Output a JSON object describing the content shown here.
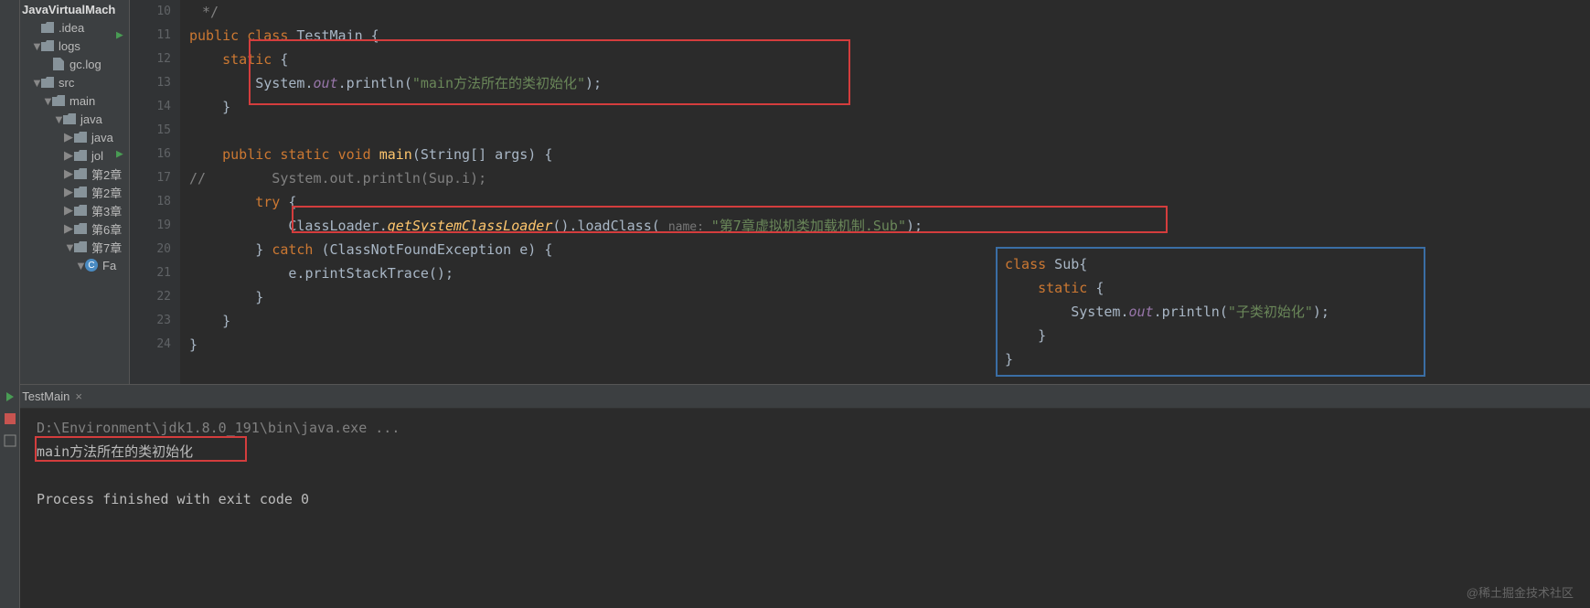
{
  "project": {
    "root": "JavaVirtualMach",
    "nodes": [
      {
        "label": ".idea",
        "type": "folder",
        "depth": 1
      },
      {
        "label": "logs",
        "type": "folder",
        "depth": 1,
        "open": true
      },
      {
        "label": "gc.log",
        "type": "file",
        "depth": 2
      },
      {
        "label": "src",
        "type": "folder",
        "depth": 1,
        "open": true
      },
      {
        "label": "main",
        "type": "folder",
        "depth": 2,
        "open": true
      },
      {
        "label": "java",
        "type": "folder",
        "depth": 3,
        "open": true
      },
      {
        "label": "java",
        "type": "folder",
        "depth": 4,
        "has_child": true
      },
      {
        "label": "jol",
        "type": "folder",
        "depth": 4,
        "has_child": true
      },
      {
        "label": "第2章",
        "type": "folder",
        "depth": 4,
        "has_child": true
      },
      {
        "label": "第2章",
        "type": "folder",
        "depth": 4,
        "has_child": true
      },
      {
        "label": "第3章",
        "type": "folder",
        "depth": 4,
        "has_child": true
      },
      {
        "label": "第6章",
        "type": "folder",
        "depth": 4,
        "has_child": true
      },
      {
        "label": "第7章",
        "type": "folder",
        "depth": 4,
        "open": true
      },
      {
        "label": "Fa",
        "type": "class",
        "depth": 5,
        "open": true
      }
    ]
  },
  "lineNumbers": [
    "10",
    "11",
    "12",
    "13",
    "14",
    "15",
    "16",
    "17",
    "18",
    "19",
    "20",
    "21",
    "22",
    "23",
    "24"
  ],
  "runMarkers": {
    "11": true,
    "16": true
  },
  "code": {
    "l10": "*/",
    "l11_kw1": "public",
    "l11_kw2": "class",
    "l11_cls": "TestMain",
    "l11_brace": " {",
    "l12_kw": "static",
    "l12_brace": " {",
    "l13_sys": "System",
    "l13_dot1": ".",
    "l13_out": "out",
    "l13_dot2": ".",
    "l13_println": "println",
    "l13_p1": "(",
    "l13_str": "\"main方法所在的类初始化\"",
    "l13_p2": ");",
    "l14": "}",
    "l16_kw1": "public",
    "l16_kw2": "static",
    "l16_kw3": "void",
    "l16_mth": "main",
    "l16_p1": "(",
    "l16_type": "String[]",
    "l16_arg": " args",
    "l16_p2": ") {",
    "l17_cmt": "//        System.out.println(Sup.i);",
    "l18_kw": "try",
    "l18_brace": " {",
    "l19_cl": "ClassLoader",
    "l19_dot": ".",
    "l19_m1": "getSystemClassLoader",
    "l19_p1": "().",
    "l19_m2": "loadClass",
    "l19_p2": "( ",
    "l19_hint": "name: ",
    "l19_str": "\"第7章虚拟机类加载机制.Sub\"",
    "l19_p3": ");",
    "l20_b1": "} ",
    "l20_kw": "catch",
    "l20_p1": " (",
    "l20_type": "ClassNotFoundException",
    "l20_arg": " e",
    "l20_p2": ") {",
    "l21_e": "e",
    "l21_dot": ".",
    "l21_mth": "printStackTrace",
    "l21_p": "();",
    "l22": "}",
    "l23": "}",
    "l24": "}"
  },
  "overlay": {
    "o1_kw": "class",
    "o1_cls": " Sub",
    "o1_brace": "{",
    "o2_kw": "static",
    "o2_brace": " {",
    "o3_sys": "System",
    "o3_dot1": ".",
    "o3_out": "out",
    "o3_dot2": ".",
    "o3_println": "println",
    "o3_p1": "(",
    "o3_str": "\"子类初始化\"",
    "o3_p2": ");",
    "o4": "}",
    "o5": "}"
  },
  "runTab": {
    "label": "TestMain"
  },
  "console": {
    "path": "D:\\Environment\\jdk1.8.0_191\\bin\\java.exe ...",
    "out1": "main方法所在的类初始化",
    "exit": "Process finished with exit code 0"
  },
  "watermark": "@稀土掘金技术社区"
}
